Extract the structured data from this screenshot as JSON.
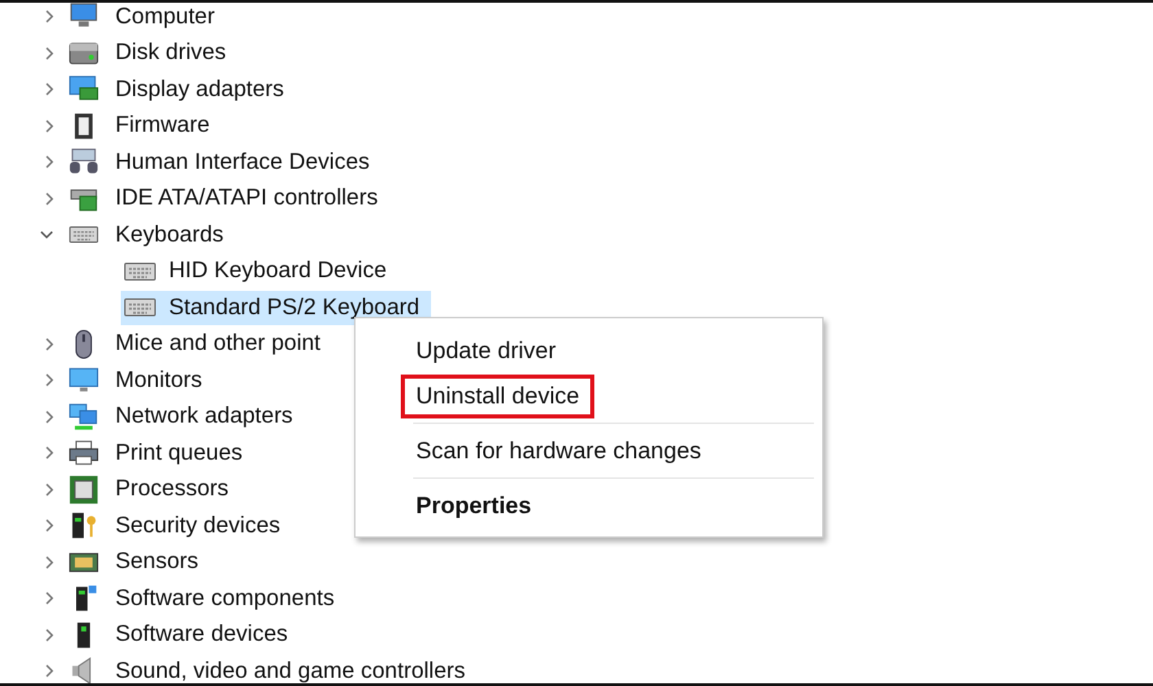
{
  "tree": {
    "items": [
      {
        "label": "Computer",
        "kind": "computer",
        "expanded": false
      },
      {
        "label": "Disk drives",
        "kind": "disk",
        "expanded": false
      },
      {
        "label": "Display adapters",
        "kind": "display",
        "expanded": false
      },
      {
        "label": "Firmware",
        "kind": "chip",
        "expanded": false
      },
      {
        "label": "Human Interface Devices",
        "kind": "hid",
        "expanded": false
      },
      {
        "label": "IDE ATA/ATAPI controllers",
        "kind": "ide",
        "expanded": false
      },
      {
        "label": "Keyboards",
        "kind": "keyboard",
        "expanded": true,
        "children": [
          {
            "label": "HID Keyboard Device",
            "kind": "keyboard",
            "selected": false
          },
          {
            "label": "Standard PS/2 Keyboard",
            "kind": "keyboard",
            "selected": true
          }
        ]
      },
      {
        "label": "Mice and other point",
        "kind": "mouse",
        "expanded": false
      },
      {
        "label": "Monitors",
        "kind": "monitor",
        "expanded": false
      },
      {
        "label": "Network adapters",
        "kind": "network",
        "expanded": false
      },
      {
        "label": "Print queues",
        "kind": "printer",
        "expanded": false
      },
      {
        "label": "Processors",
        "kind": "processor",
        "expanded": false
      },
      {
        "label": "Security devices",
        "kind": "security",
        "expanded": false
      },
      {
        "label": "Sensors",
        "kind": "sensor",
        "expanded": false
      },
      {
        "label": "Software components",
        "kind": "swcomp",
        "expanded": false
      },
      {
        "label": "Software devices",
        "kind": "swdev",
        "expanded": false
      },
      {
        "label": "Sound, video and game controllers",
        "kind": "sound",
        "expanded": false
      }
    ]
  },
  "context_menu": {
    "items": [
      {
        "kind": "item",
        "label": "Update driver",
        "bold": false,
        "outlined": false
      },
      {
        "kind": "item",
        "label": "Uninstall device",
        "bold": false,
        "outlined": true
      },
      {
        "kind": "separator"
      },
      {
        "kind": "item",
        "label": "Scan for hardware changes",
        "bold": false,
        "outlined": false
      },
      {
        "kind": "separator"
      },
      {
        "kind": "item",
        "label": "Properties",
        "bold": true,
        "outlined": false
      }
    ]
  }
}
